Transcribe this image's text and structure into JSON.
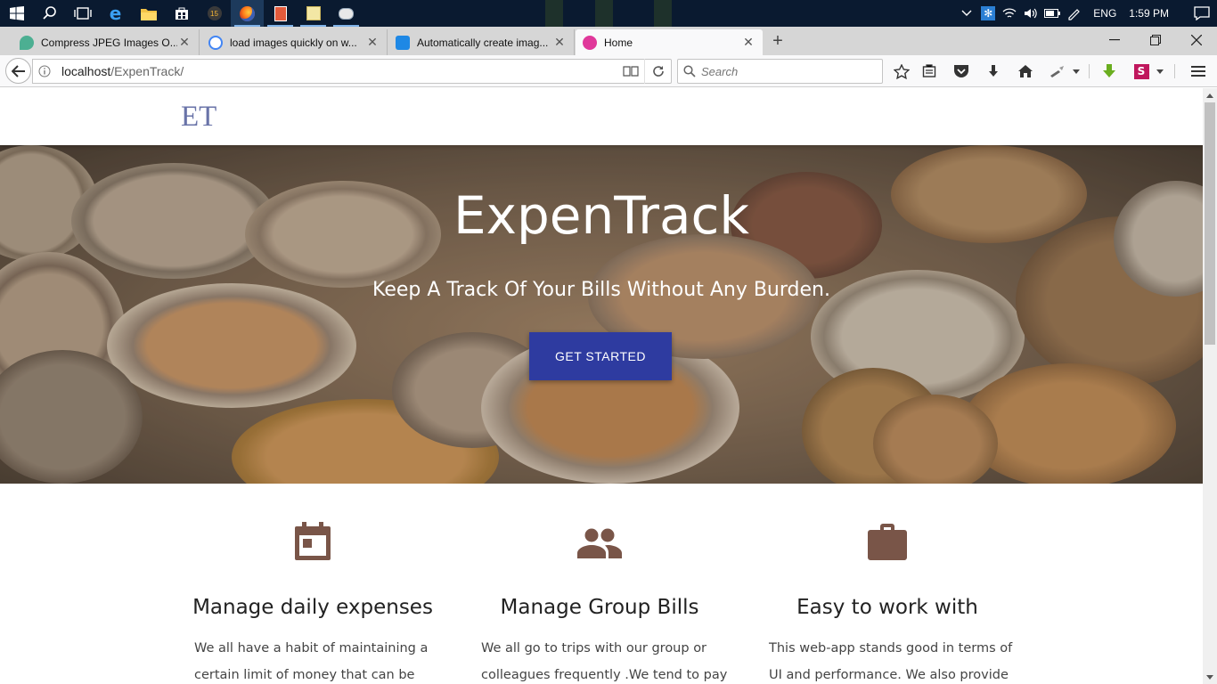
{
  "browser": {
    "tabs": [
      {
        "title": "Compress JPEG Images O...",
        "favicon_color": "#4caf92"
      },
      {
        "title": "load images quickly on w...",
        "favicon_color": "#4285f4"
      },
      {
        "title": "Automatically create imag...",
        "favicon_color": "#1e88e5"
      },
      {
        "title": "Home",
        "favicon_color": "#e0389a"
      }
    ],
    "url_host": "localhost",
    "url_path": "/ExpenTrack/",
    "search_placeholder": "Search"
  },
  "taskbar": {
    "language": "ENG",
    "time": "1:59 PM"
  },
  "site": {
    "logo": "ET",
    "hero_title": "ExpenTrack",
    "hero_subtitle": "Keep A Track Of Your Bills Without Any Burden.",
    "cta_label": "GET STARTED",
    "accent_color": "#2e3ba0",
    "icon_color": "#795548",
    "features": [
      {
        "icon": "calendar-icon",
        "title": "Manage daily expenses",
        "description": "We all have a habit of maintaining a certain limit of money that can be spent"
      },
      {
        "icon": "group-icon",
        "title": "Manage Group Bills",
        "description": "We all go to trips with our group or colleagues frequently .We tend to pay"
      },
      {
        "icon": "briefcase-icon",
        "title": "Easy to work with",
        "description": "This web-app stands good in terms of UI and performance. We also provide you"
      }
    ]
  }
}
